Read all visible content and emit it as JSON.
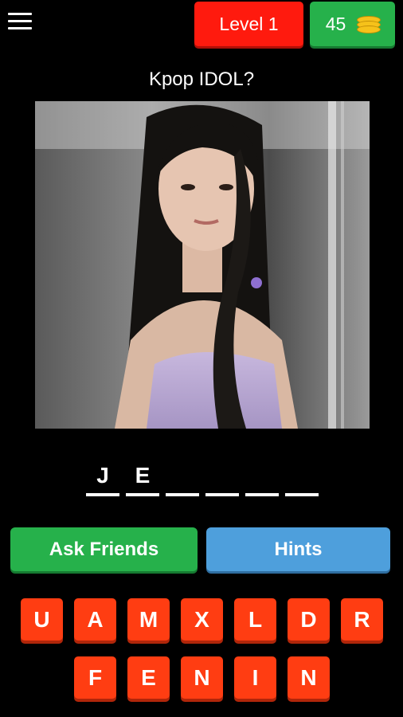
{
  "header": {
    "level_label": "Level 1",
    "coins": "45",
    "menu_icon": "hamburger-menu-icon",
    "coin_icon": "coin-stack-icon",
    "colors": {
      "level": "#ff1a0e",
      "coins": "#26b14b"
    }
  },
  "question": {
    "text": "Kpop IDOL?"
  },
  "answer": {
    "slots": [
      "J",
      "E",
      "",
      "",
      "",
      ""
    ]
  },
  "actions": {
    "ask_friends": "Ask Friends",
    "hints": "Hints"
  },
  "keyboard": {
    "row1": [
      "U",
      "A",
      "M",
      "X",
      "L",
      "D",
      "R"
    ],
    "row2": [
      "F",
      "E",
      "N",
      "I",
      "N"
    ],
    "key_color": "#ff3d12"
  }
}
